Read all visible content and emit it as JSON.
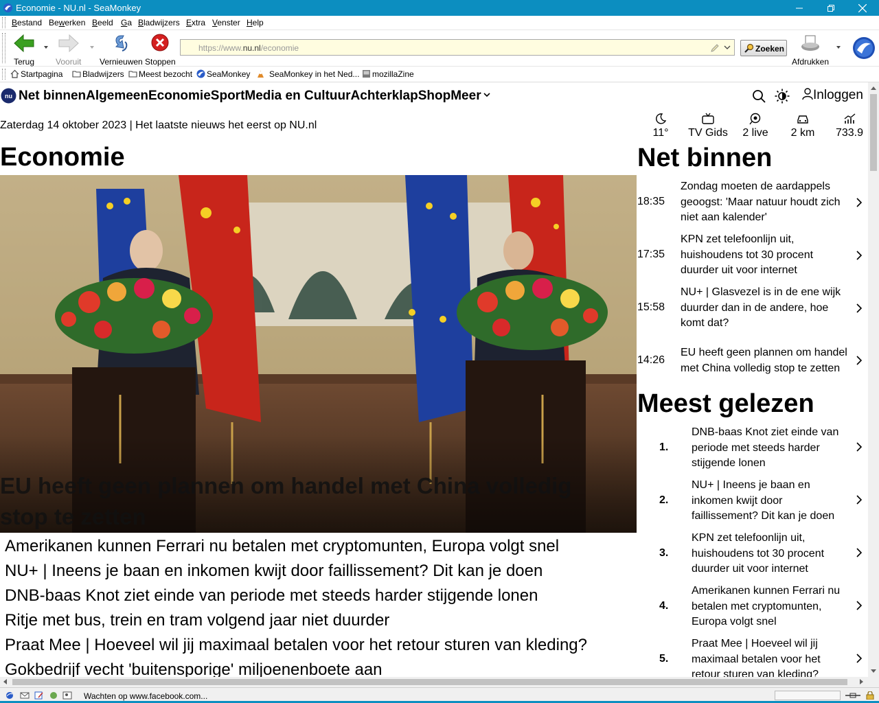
{
  "window": {
    "title": "Economie - NU.nl - SeaMonkey"
  },
  "menu": [
    "Bestand",
    "Bewerken",
    "Beeld",
    "Ga",
    "Bladwijzers",
    "Extra",
    "Venster",
    "Help"
  ],
  "menu_access": [
    "B",
    "w",
    "B",
    "G",
    "B",
    "E",
    "V",
    "H"
  ],
  "toolbar": {
    "back": "Terug",
    "forward": "Vooruit",
    "reload": "Vernieuwen",
    "stop": "Stoppen",
    "search": "Zoeken",
    "print": "Afdrukken"
  },
  "url": {
    "scheme": "https://www.",
    "host": "nu.nl",
    "path": "/economie"
  },
  "bookmarks": [
    "Startpagina",
    "Bladwijzers",
    "Meest bezocht",
    "SeaMonkey",
    "SeaMonkey in het Ned...",
    "mozillaZine"
  ],
  "site": {
    "nav": [
      "Net binnen",
      "Algemeen",
      "Economie",
      "Sport",
      "Media en Cultuur",
      "Achterklap",
      "Shop",
      "Meer"
    ],
    "login": "Inloggen",
    "date_line": "Zaterdag 14 oktober 2023 | Het laatste nieuws het eerst op NU.nl",
    "widgets": [
      {
        "icon": "moon-icon",
        "label": "11°"
      },
      {
        "icon": "tv-icon",
        "label": "TV Gids"
      },
      {
        "icon": "live-icon",
        "label": "2 live"
      },
      {
        "icon": "car-icon",
        "label": "2 km"
      },
      {
        "icon": "stocks-icon",
        "label": "733.9"
      }
    ]
  },
  "main": {
    "section_title": "Economie",
    "hero_title": "EU heeft geen plannen om handel met China volledig stop te zetten",
    "headlines": [
      "Amerikanen kunnen Ferrari nu betalen met cryptomunten, Europa volgt snel",
      "NU+ | Ineens je baan en inkomen kwijt door faillissement? Dit kan je doen",
      "DNB-baas Knot ziet einde van periode met steeds harder stijgende lonen",
      "Ritje met bus, trein en tram volgend jaar niet duurder",
      "Praat Mee | Hoeveel wil jij maximaal betalen voor het retour sturen van kleding?",
      "Gokbedrijf vecht 'buitensporige' miljoenenboete aan"
    ]
  },
  "sidebar": {
    "net_binnen_title": "Net binnen",
    "net_binnen": [
      {
        "time": "18:35",
        "text": "Zondag moeten de aardappels geoogst: 'Maar natuur houdt zich niet aan kalender'"
      },
      {
        "time": "17:35",
        "text": "KPN zet telefoonlijn uit, huishoudens tot 30 procent duurder uit voor internet"
      },
      {
        "time": "15:58",
        "text": "NU+ | Glasvezel is in de ene wijk duurder dan in de andere, hoe komt dat?"
      },
      {
        "time": "14:26",
        "text": "EU heeft geen plannen om handel met China volledig stop te zetten"
      }
    ],
    "meest_gelezen_title": "Meest gelezen",
    "meest_gelezen": [
      {
        "rank": "1.",
        "text": "DNB-baas Knot ziet einde van periode met steeds harder stijgende lonen"
      },
      {
        "rank": "2.",
        "text": "NU+ | Ineens je baan en inkomen kwijt door faillissement? Dit kan je doen"
      },
      {
        "rank": "3.",
        "text": "KPN zet telefoonlijn uit, huishoudens tot 30 procent duurder uit voor internet"
      },
      {
        "rank": "4.",
        "text": "Amerikanen kunnen Ferrari nu betalen met cryptomunten, Europa volgt snel"
      },
      {
        "rank": "5.",
        "text": "Praat Mee | Hoeveel wil jij maximaal betalen voor het retour sturen van kleding?"
      }
    ]
  },
  "status": {
    "text": "Wachten op www.facebook.com..."
  },
  "colors": {
    "titlebar": "#0c8ec0",
    "urlbar_bg": "#fffde0",
    "stop_red": "#d42020",
    "back_green": "#3aa020"
  }
}
